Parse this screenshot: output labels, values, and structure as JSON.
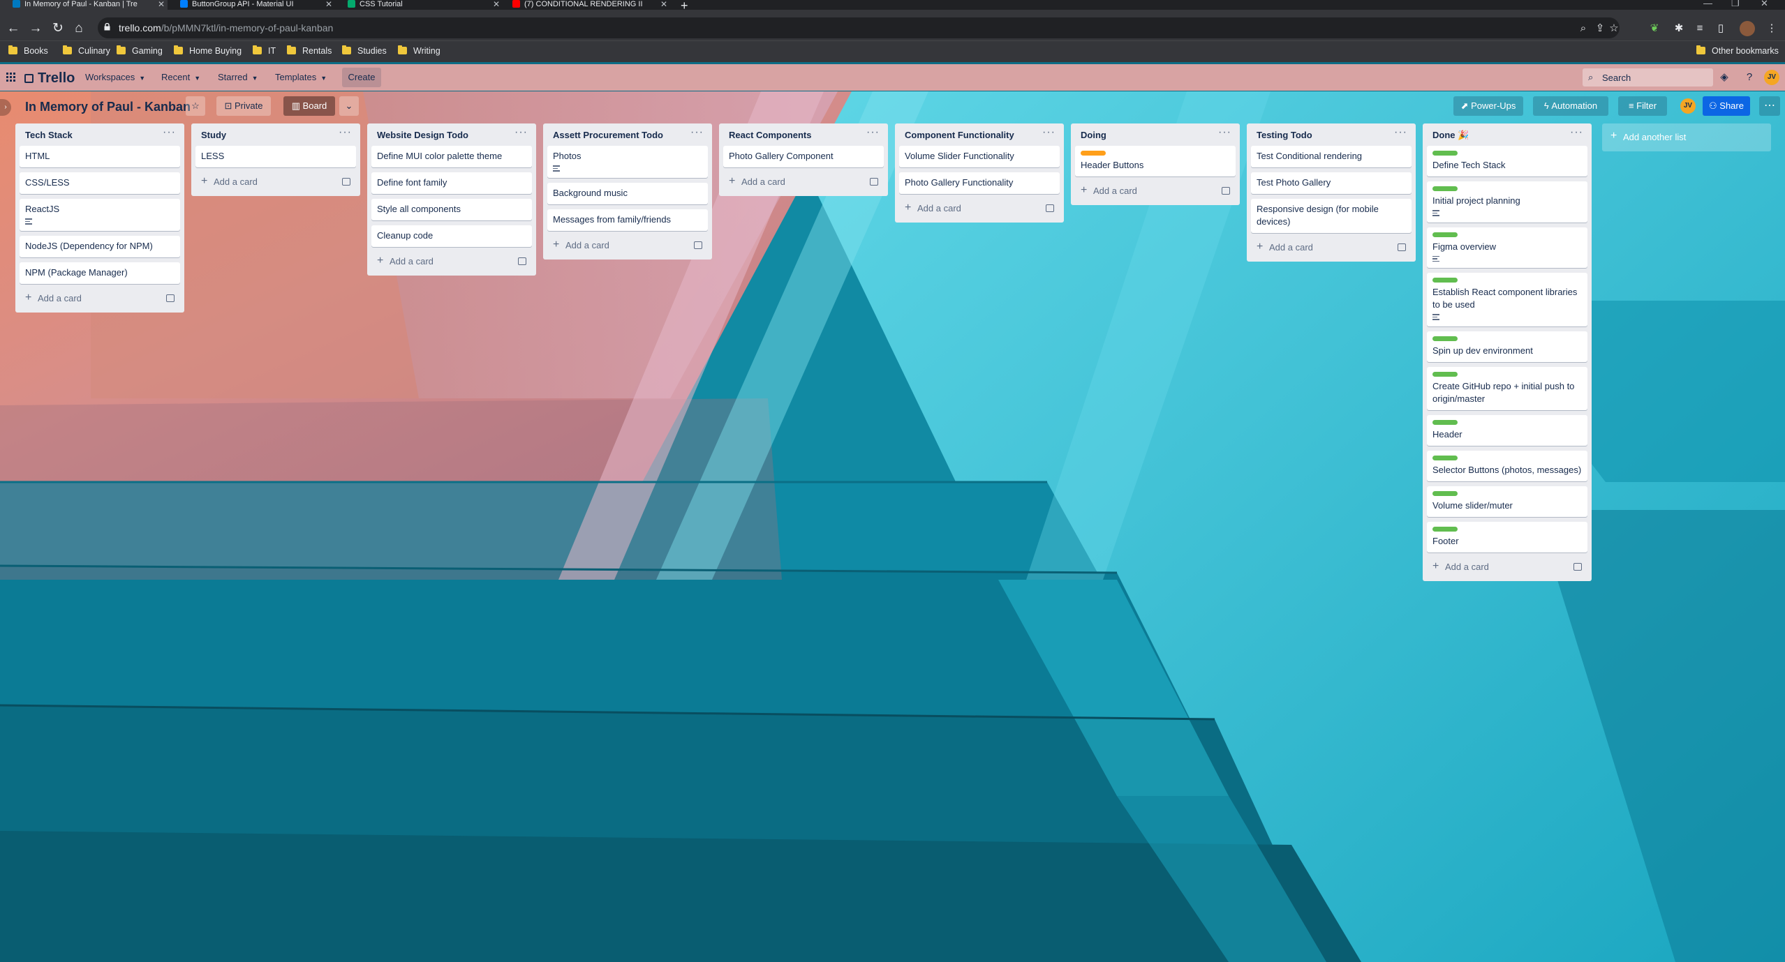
{
  "browser": {
    "tabs": [
      {
        "title": "In Memory of Paul - Kanban | Tre",
        "color": "#0079bf",
        "active": true
      },
      {
        "title": "ButtonGroup API - Material UI",
        "color": "#007fff",
        "active": false
      },
      {
        "title": "CSS Tutorial",
        "color": "#04aa6d",
        "active": false
      },
      {
        "title": "(7) CONDITIONAL RENDERING II",
        "color": "#ff0000",
        "active": false
      }
    ],
    "new_tab": "+",
    "url_host": "trello.com",
    "url_path": "/b/pMMN7ktl/in-memory-of-paul-kanban",
    "bookmarks": [
      "Books",
      "Culinary",
      "Gaming",
      "Home Buying",
      "IT",
      "Rentals",
      "Studies",
      "Writing"
    ],
    "other_bookmarks": "Other bookmarks"
  },
  "header": {
    "logo": "Trello",
    "menus": [
      "Workspaces",
      "Recent",
      "Starred",
      "Templates"
    ],
    "create": "Create",
    "search_placeholder": "Search",
    "avatar": "JV"
  },
  "board": {
    "title": "In Memory of Paul - Kanban",
    "visibility": "Private",
    "view": "Board",
    "power_ups": "Power-Ups",
    "automation": "Automation",
    "filter": "Filter",
    "share": "Share",
    "member": "JV",
    "add_list": "Add another list",
    "add_card": "Add a card"
  },
  "lists": [
    {
      "title": "Tech Stack",
      "cards": [
        {
          "text": "HTML"
        },
        {
          "text": "CSS/LESS"
        },
        {
          "text": "ReactJS",
          "desc": true
        },
        {
          "text": "NodeJS (Dependency for NPM)"
        },
        {
          "text": "NPM (Package Manager)"
        }
      ]
    },
    {
      "title": "Study",
      "cards": [
        {
          "text": "LESS"
        }
      ]
    },
    {
      "title": "Website Design Todo",
      "cards": [
        {
          "text": "Define MUI color palette theme"
        },
        {
          "text": "Define font family"
        },
        {
          "text": "Style all components"
        },
        {
          "text": "Cleanup code"
        }
      ]
    },
    {
      "title": "Assett Procurement Todo",
      "cards": [
        {
          "text": "Photos",
          "desc": true
        },
        {
          "text": "Background music"
        },
        {
          "text": "Messages from family/friends"
        }
      ]
    },
    {
      "title": "React Components",
      "cards": [
        {
          "text": "Photo Gallery Component"
        }
      ]
    },
    {
      "title": "Component Functionality",
      "cards": [
        {
          "text": "Volume Slider Functionality"
        },
        {
          "text": "Photo Gallery Functionality"
        }
      ]
    },
    {
      "title": "Doing",
      "cards": [
        {
          "text": "Header Buttons",
          "label": "orange"
        }
      ]
    },
    {
      "title": "Testing Todo",
      "cards": [
        {
          "text": "Test Conditional rendering"
        },
        {
          "text": "Test Photo Gallery"
        },
        {
          "text": "Responsive design (for mobile devices)"
        }
      ]
    },
    {
      "title": "Done 🎉",
      "cards": [
        {
          "text": "Define Tech Stack",
          "label": "green"
        },
        {
          "text": "Initial project planning",
          "label": "green",
          "desc": true
        },
        {
          "text": "Figma overview",
          "label": "green",
          "desc": true
        },
        {
          "text": "Establish React component libraries to be used",
          "label": "green",
          "desc": true
        },
        {
          "text": "Spin up dev environment",
          "label": "green"
        },
        {
          "text": "Create GitHub repo + initial push to origin/master",
          "label": "green"
        },
        {
          "text": "Header",
          "label": "green"
        },
        {
          "text": "Selector Buttons (photos, messages)",
          "label": "green"
        },
        {
          "text": "Volume slider/muter",
          "label": "green"
        },
        {
          "text": "Footer",
          "label": "green"
        }
      ]
    }
  ]
}
